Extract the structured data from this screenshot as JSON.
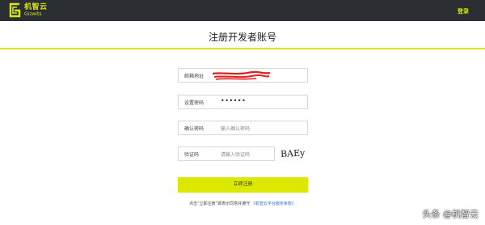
{
  "header": {
    "logo_cn": "机智云",
    "logo_en": "Gizwits",
    "login_label": "登录"
  },
  "page_title": "注册开发者账号",
  "form": {
    "email": {
      "label": "邮箱地址",
      "value": ""
    },
    "password": {
      "label": "设置密码",
      "value": "••••••"
    },
    "confirm": {
      "label": "确认密码",
      "placeholder": "输入确认密码"
    },
    "captcha": {
      "label": "验证码",
      "placeholder": "请输入验证码",
      "image_text": "BAEy"
    },
    "submit_label": "立即注册"
  },
  "terms": {
    "text": "点击“立即注册”即表示同意并遵守",
    "link": "《机智云平台服务条款》"
  },
  "watermark": "头条 @机智云",
  "colors": {
    "accent": "#dde800",
    "topbar": "#2b2f33",
    "redaction": "#e0201c"
  }
}
